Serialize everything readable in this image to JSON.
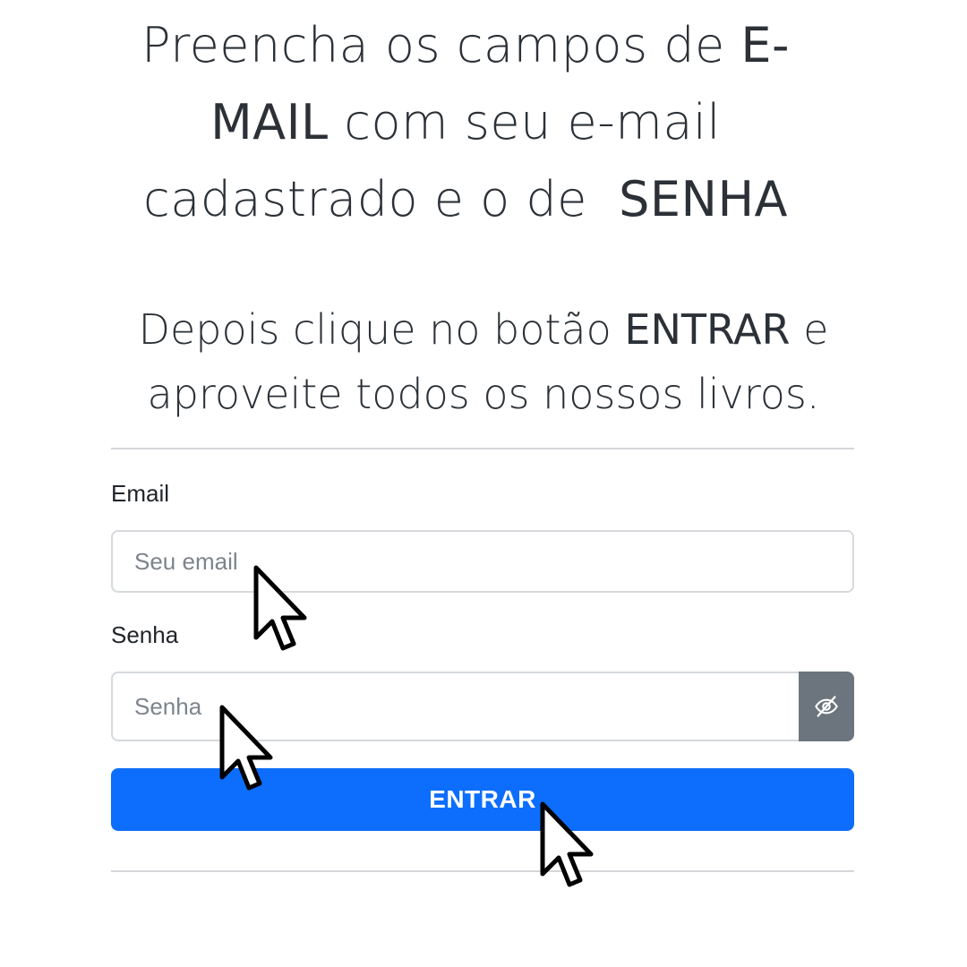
{
  "instructions": {
    "line1_a": "Preencha os campos de ",
    "line1_b": "E-",
    "line2_a": "MAIL",
    "line2_b": " com seu e-mail",
    "line3_a": "cadastrado e o de  ",
    "line3_b": "SENHA",
    "sub1_a": "Depois clique no botão ",
    "sub1_b": "ENTRAR",
    "sub1_c": " e",
    "sub2": "aproveite todos os nossos livros."
  },
  "form": {
    "email_label": "Email",
    "email_placeholder": "Seu email",
    "email_value": "",
    "password_label": "Senha",
    "password_placeholder": "Senha",
    "password_value": "",
    "toggle_icon": "eye-slash-icon",
    "submit_label": "ENTRAR"
  },
  "colors": {
    "primary": "#0d6efd",
    "secondary": "#6c757d",
    "text": "#2b3137"
  },
  "pointers": [
    "arrow-cursor-icon",
    "arrow-cursor-icon",
    "arrow-cursor-icon"
  ]
}
